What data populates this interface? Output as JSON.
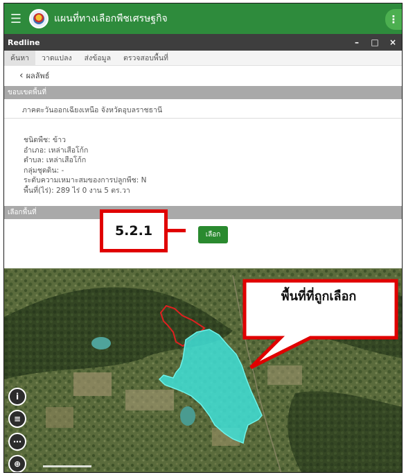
{
  "app": {
    "title": "แผนที่ทางเลือกพืชเศรษฐกิจ"
  },
  "window": {
    "title": "Redline"
  },
  "tabs": [
    "ค้นหา",
    "วาดแปลง",
    "ส่งข้อมูล",
    "ตรวจสอบพื้นที่"
  ],
  "back_label": "ผลลัพธ์",
  "boundary": {
    "header": "ขอบเขตพื้นที่",
    "region": "ภาคตะวันออกเฉียงเหนือ จังหวัดอุบลราชธานี"
  },
  "details": [
    "ชนิดพืช: ข้าว",
    "อำเภอ: เหล่าเสือโก้ก",
    "ตำบล: เหล่าเสือโก้ก",
    "กลุ่มชุดดิน: -",
    "ระดับความเหมาะสมของการปลูกพืช: N",
    "พื้นที่(ไร่): 289 ไร่ 0 งาน 5 ตร.วา"
  ],
  "select_area": {
    "header": "เลือกพื้นที่",
    "button_label": "เลือก"
  },
  "annotations": {
    "step_label": "5.2.1",
    "map_callout": "พื้นที่ที่ถูกเลือก"
  },
  "map_controls": [
    {
      "icon": "info-icon"
    },
    {
      "icon": "layers-icon"
    },
    {
      "icon": "more-icon"
    },
    {
      "icon": "locate-icon"
    }
  ],
  "colors": {
    "app_bar": "#2e8b3c",
    "selected_area": "#40e0d8",
    "redline_outline": "#e02020",
    "callout": "#e00000"
  }
}
